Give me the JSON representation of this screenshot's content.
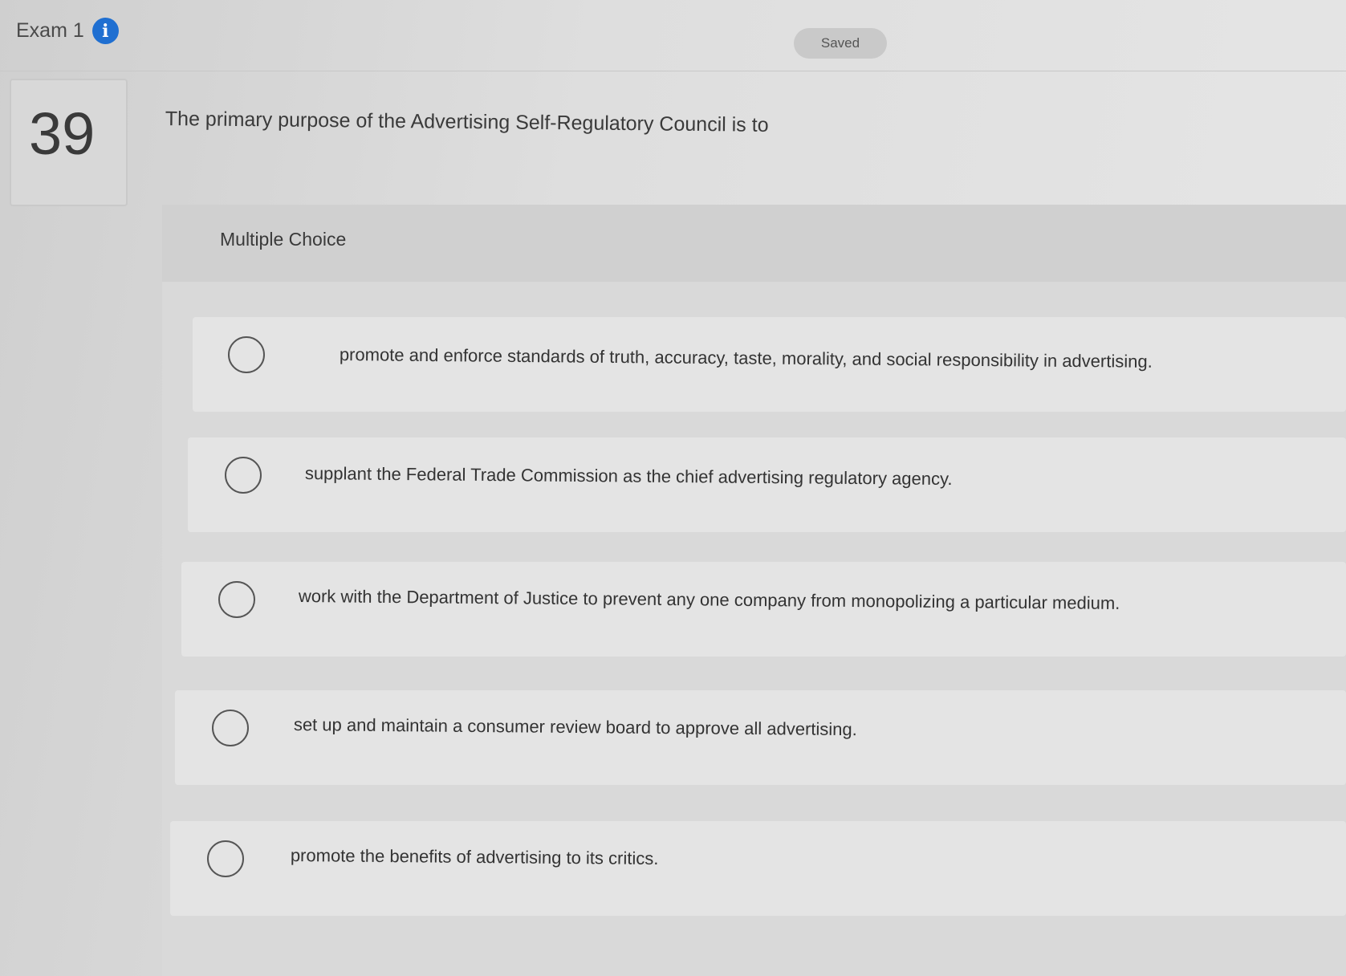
{
  "header": {
    "exam_title": "Exam 1",
    "info_icon": "info-icon",
    "status": "Saved"
  },
  "question": {
    "number": "39",
    "text": "The primary purpose of the Advertising Self-Regulatory Council is to"
  },
  "answer_section": {
    "type_label": "Multiple Choice",
    "options": [
      {
        "text": "promote and enforce standards of truth, accuracy, taste, morality, and social responsibility in advertising.",
        "selected": false
      },
      {
        "text": "supplant the Federal Trade Commission as the chief advertising regulatory agency.",
        "selected": false
      },
      {
        "text": "work with the Department of Justice to prevent any one company from monopolizing a particular medium.",
        "selected": false
      },
      {
        "text": "set up and maintain a consumer review board to approve all advertising.",
        "selected": false
      },
      {
        "text": "promote the benefits of advertising to its critics.",
        "selected": false
      }
    ]
  },
  "colors": {
    "info_icon": "#1f6fd1",
    "background": "#dcdcdc"
  }
}
